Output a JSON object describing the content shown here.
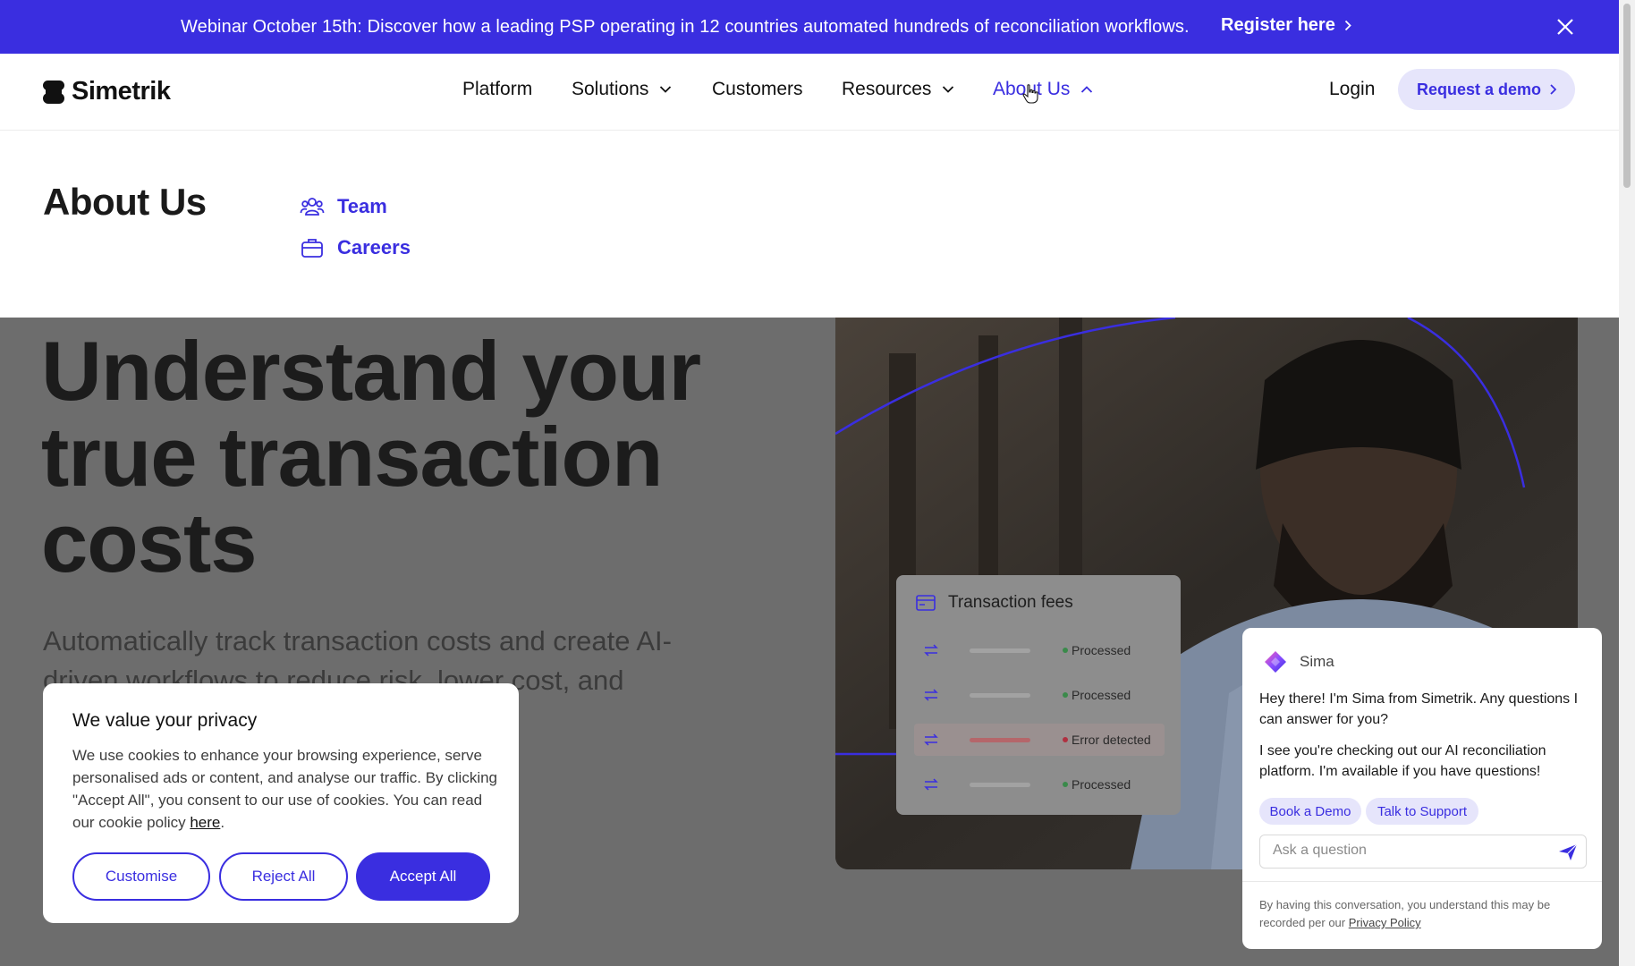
{
  "promo": {
    "text": "Webinar October 15th: Discover how a leading PSP operating in 12 countries automated hundreds of reconciliation workflows.",
    "link": "Register here"
  },
  "header": {
    "brand": "Simetrik",
    "nav": {
      "platform": "Platform",
      "solutions": "Solutions",
      "customers": "Customers",
      "resources": "Resources",
      "about": "About Us"
    },
    "login": "Login",
    "demo": "Request a demo"
  },
  "mega": {
    "title": "About Us",
    "items": [
      {
        "label": "Team",
        "icon": "team-icon"
      },
      {
        "label": "Careers",
        "icon": "briefcase-icon"
      }
    ]
  },
  "hero": {
    "title": "Understand your true transaction costs",
    "subtitle": "Automatically track transaction costs and create AI-driven workflows to reduce risk, lower cost, and maximize value for all stakeholders."
  },
  "fees_card": {
    "title": "Transaction fees",
    "rows": [
      {
        "status": "Processed"
      },
      {
        "status": "Processed"
      },
      {
        "status": "Error detected"
      },
      {
        "status": "Processed"
      }
    ]
  },
  "cookie": {
    "title": "We value your privacy",
    "body": "We use cookies to enhance your browsing experience, serve personalised ads or content, and analyse our traffic. By clicking \"Accept All\", you consent to our use of cookies. You can read our cookie policy ",
    "link": "here",
    "customise": "Customise",
    "reject": "Reject All",
    "accept": "Accept All"
  },
  "chat": {
    "name": "Sima",
    "msg1": "Hey there! I'm Sima from Simetrik. Any questions I can answer for you?",
    "msg2": "I see you're checking out our AI reconciliation platform. I'm available if you have questions!",
    "chip_demo": "Book a Demo",
    "chip_support": "Talk to Support",
    "placeholder": "Ask a question",
    "footer": "By having this conversation, you understand this may be recorded per our ",
    "footer_link": "Privacy Policy"
  },
  "colors": {
    "brand": "#3a2ee0",
    "overlay": "#6d6d6d"
  }
}
